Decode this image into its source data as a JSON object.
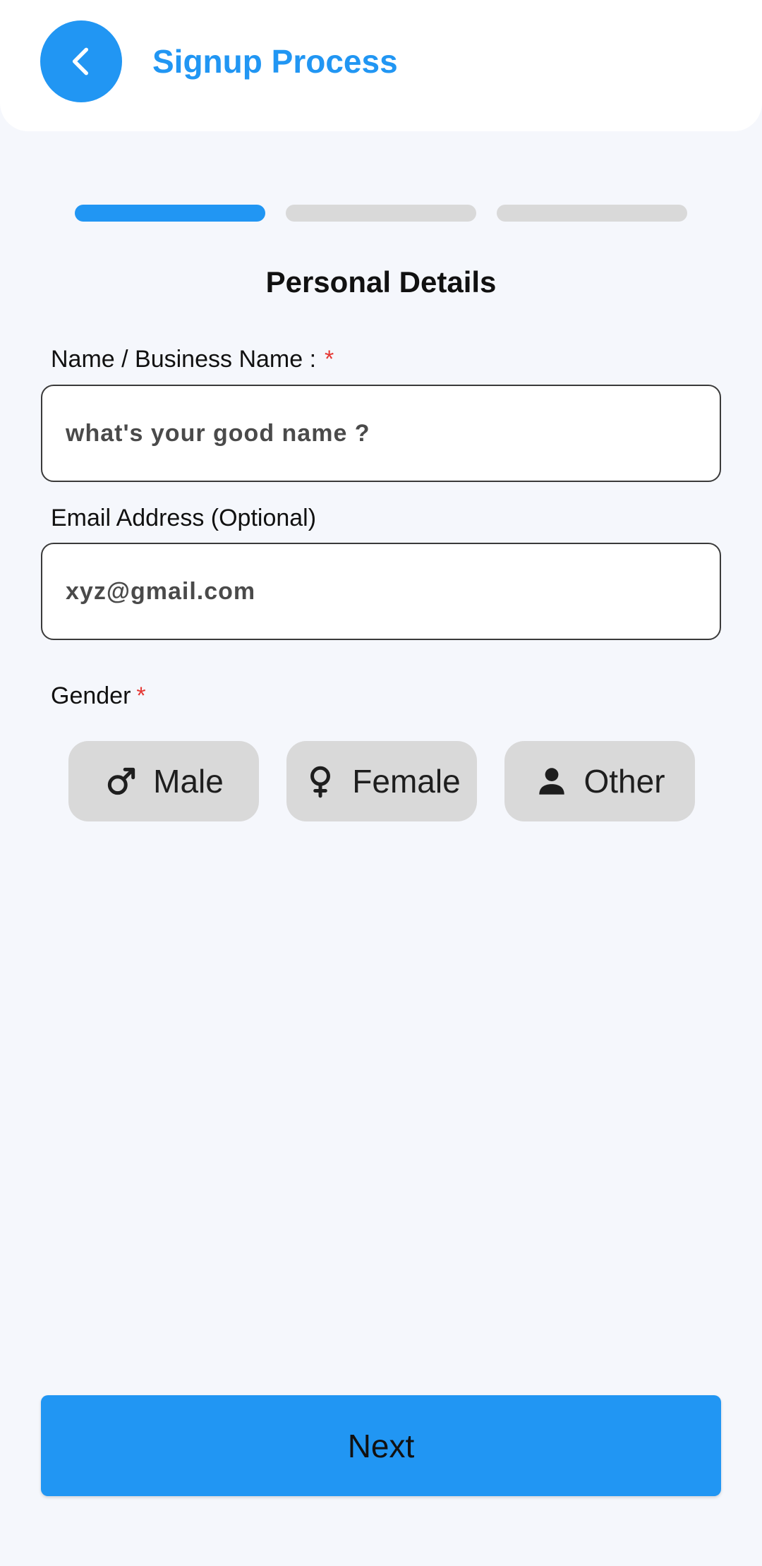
{
  "header": {
    "title": "Signup Process",
    "back_icon": "chevron-left-icon"
  },
  "colors": {
    "accent": "#2196f3",
    "required": "#e53935",
    "chip_bg": "#d9d9d9",
    "page_bg": "#f5f7fc"
  },
  "progress": {
    "total_steps": 3,
    "current_step": 1
  },
  "form": {
    "section_title": "Personal Details",
    "name": {
      "label": "Name / Business Name :",
      "required_mark": "*",
      "placeholder": "what's your good name ?",
      "value": ""
    },
    "email": {
      "label": "Email Address (Optional)",
      "placeholder": "xyz@gmail.com",
      "value": ""
    },
    "gender": {
      "label": "Gender",
      "required_mark": "*",
      "options": [
        {
          "label": "Male",
          "icon": "male-icon"
        },
        {
          "label": "Female",
          "icon": "female-icon"
        },
        {
          "label": "Other",
          "icon": "person-icon"
        }
      ]
    }
  },
  "footer": {
    "next_label": "Next"
  }
}
